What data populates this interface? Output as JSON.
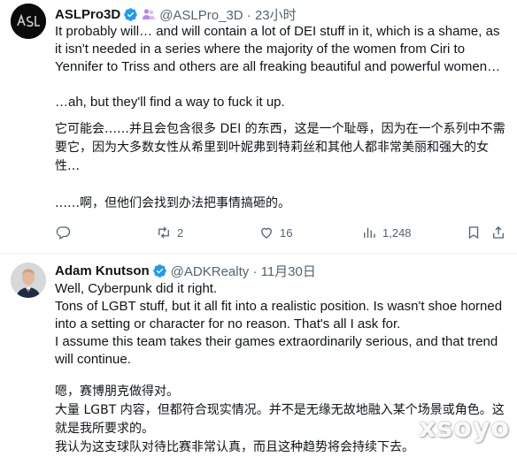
{
  "post1": {
    "name": "ASLPro3D",
    "handle": "@ASLPro_3D · 23小时",
    "paragraphs": [
      "It probably will… and will contain a lot of DEI stuff in it, which is a shame, as it isn't needed in a series where the majority of the women from Ciri to Yennifer to Triss and others are all freaking beautiful and powerful women…",
      "…ah, but they'll find a way to fuck it up.",
      "它可能会……并且会包含很多 DEI 的东西，这是一个耻辱，因为在一个系列中不需要它，因为大多数女性从希里到叶妮弗到特莉丝和其他人都非常美丽和强大的女性…",
      "……啊，但他们会找到办法把事情搞砸的。"
    ],
    "actions": {
      "replies": "",
      "retweets": "2",
      "likes": "16",
      "views": "1,248"
    },
    "icons": [
      "reply-icon",
      "retweet-icon",
      "like-icon",
      "views-icon",
      "bookmark-icon",
      "share-icon"
    ]
  },
  "post2": {
    "name": "Adam Knutson",
    "handle": "@ADKRealty · 11月30日",
    "paragraphs": [
      "Well, Cyberpunk did it right.\nTons of LGBT stuff, but it all fit into a realistic position. Is wasn't shoe horned into a setting or character for no reason. That's all I ask for.\nI assume this team takes their games extraordinarily serious, and that trend will continue.",
      "嗯，赛博朋克做得对。\n大量 LGBT 内容，但都符合现实情况。并不是无缘无故地融入某个场景或角色。这就是我所要求的。\n我认为这支球队对待比赛非常认真，而且这种趋势将会持续下去。"
    ]
  },
  "watermark": "xsoyo",
  "colors": {
    "verified": "#1d9bf0",
    "muted": "#536471",
    "text": "#0f1419",
    "badge": "#7856ff"
  }
}
